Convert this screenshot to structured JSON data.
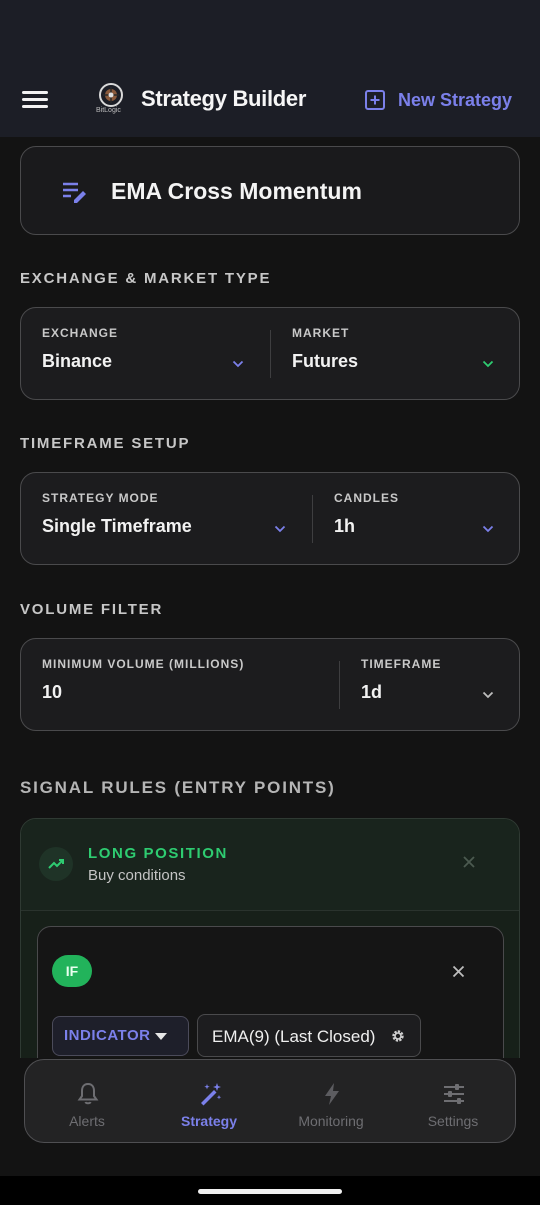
{
  "app_bar": {
    "logo_text": "BitLogic",
    "title": "Strategy Builder",
    "new_strategy_label": "New Strategy"
  },
  "strategy": {
    "name": "EMA Cross Momentum"
  },
  "sections": {
    "exchange": "EXCHANGE & MARKET TYPE",
    "timeframe": "TIMEFRAME SETUP",
    "volume": "VOLUME FILTER",
    "signals": "SIGNAL RULES (ENTRY POINTS)"
  },
  "exchange_row": {
    "exchange_label": "EXCHANGE",
    "exchange_value": "Binance",
    "market_label": "MARKET",
    "market_value": "Futures"
  },
  "timeframe_row": {
    "mode_label": "STRATEGY MODE",
    "mode_value": "Single Timeframe",
    "candles_label": "CANDLES",
    "candles_value": "1h"
  },
  "volume_row": {
    "min_volume_label": "MINIMUM VOLUME (MILLIONS)",
    "min_volume_value": "10",
    "timeframe_label": "TIMEFRAME",
    "timeframe_value": "1d"
  },
  "long_position": {
    "title": "LONG POSITION",
    "subtitle": "Buy conditions",
    "condition": {
      "if_label": "IF",
      "indicator_label": "INDICATOR",
      "indicator_value": "EMA(9) (Last Closed)"
    }
  },
  "bottom_nav": {
    "items": [
      {
        "label": "Alerts",
        "icon": "bell-icon"
      },
      {
        "label": "Strategy",
        "icon": "magic-wand-icon",
        "active": true
      },
      {
        "label": "Monitoring",
        "icon": "lightning-icon"
      },
      {
        "label": "Settings",
        "icon": "sliders-icon"
      }
    ]
  },
  "colors": {
    "accent": "#7b80ea",
    "long_green": "#2ecc71",
    "background": "#131313",
    "app_bar": "#1c1e26"
  }
}
